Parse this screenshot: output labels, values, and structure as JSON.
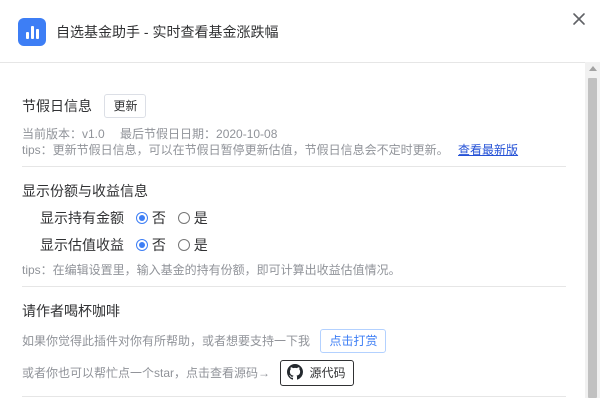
{
  "window": {
    "title": "自选基金助手 - 实时查看基金涨跌幅",
    "app_icon": "bar-chart-icon",
    "close_icon": "close-icon",
    "accent_color": "#3d7ef5"
  },
  "holiday": {
    "title": "节假日信息",
    "update_button": "更新",
    "version_line": "当前版本：v1.0　 最后节假日日期：2020-10-08",
    "tips": "tips：更新节假日信息，可以在节假日暂停更新估值，节假日信息会不定时更新。",
    "latest_link": "查看最新版"
  },
  "display": {
    "title": "显示份额与收益信息",
    "options": [
      {
        "label": "显示持有金额",
        "choices": [
          "否",
          "是"
        ],
        "selected": "否"
      },
      {
        "label": "显示估值收益",
        "choices": [
          "否",
          "是"
        ],
        "selected": "否"
      }
    ],
    "tips": "tips：在编辑设置里，输入基金的持有份额，即可计算出收益估值情况。"
  },
  "coffee": {
    "title": "请作者喝杯咖啡",
    "support_text": "如果你觉得此插件对你有所帮助，或者想要支持一下我",
    "reward_button": "点击打赏",
    "star_text": "或者你也可以帮忙点一个star，点击查看源码→",
    "source_button": "源代码",
    "github_icon": "github-icon"
  }
}
